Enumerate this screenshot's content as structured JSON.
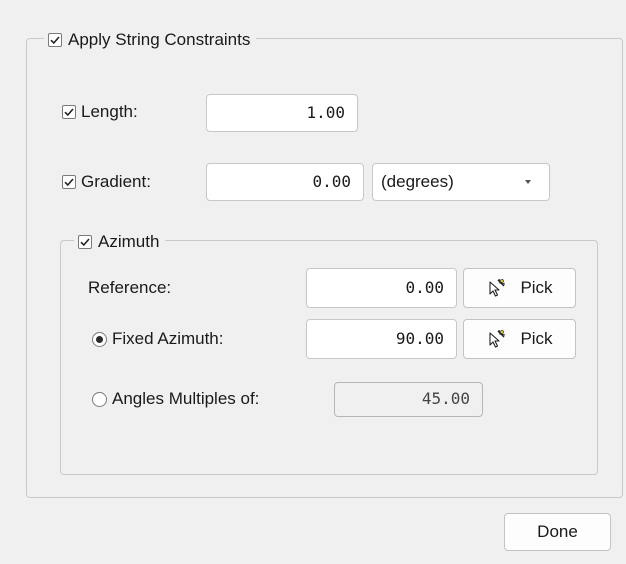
{
  "constraints": {
    "title": "Apply String Constraints",
    "length": {
      "label": "Length:",
      "value": "1.00",
      "checked": true
    },
    "gradient": {
      "label": "Gradient:",
      "value": "0.00",
      "unit": "(degrees)",
      "checked": true
    }
  },
  "azimuth": {
    "title": "Azimuth",
    "checked": true,
    "reference": {
      "label": "Reference:",
      "value": "0.00",
      "pick_label": "Pick"
    },
    "fixed": {
      "label": "Fixed Azimuth:",
      "value": "90.00",
      "pick_label": "Pick",
      "selected": true
    },
    "multiples": {
      "label": "Angles Multiples of:",
      "value": "45.00",
      "selected": false
    }
  },
  "footer": {
    "done_label": "Done"
  }
}
